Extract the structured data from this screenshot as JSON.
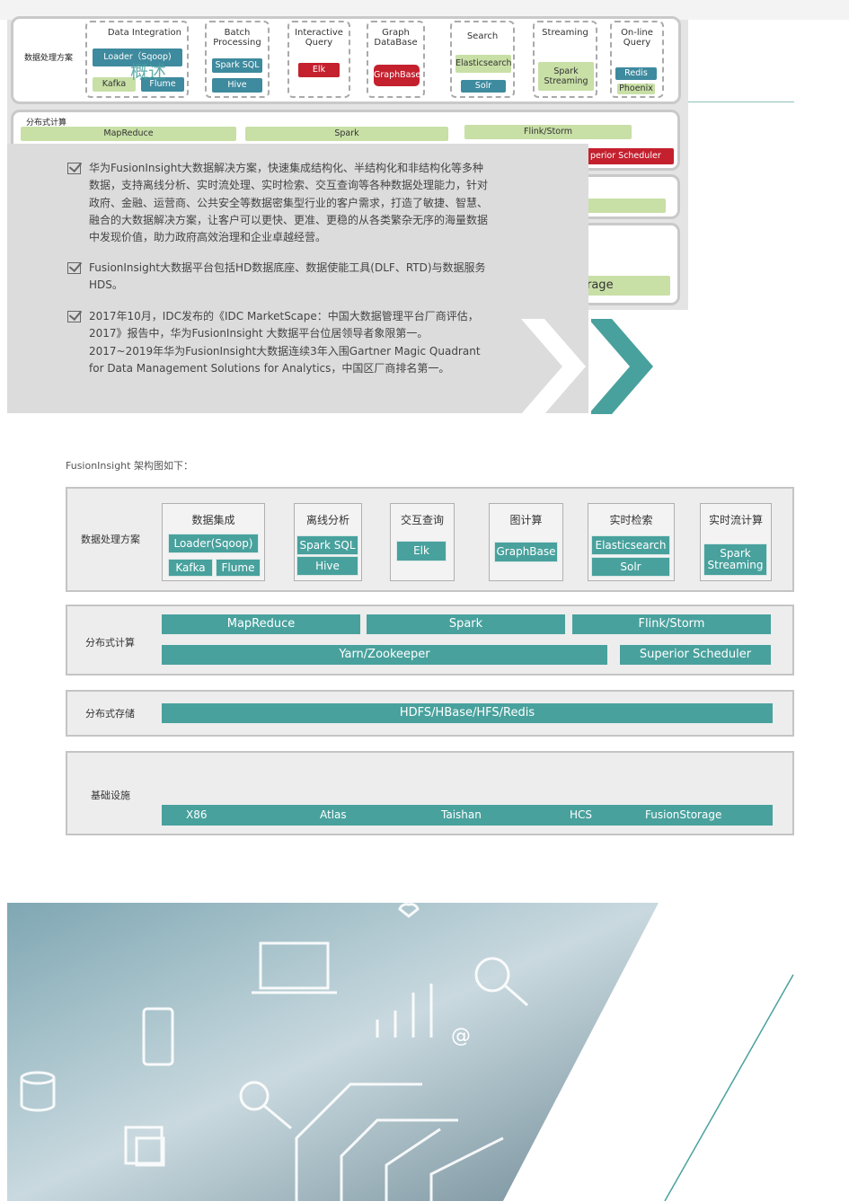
{
  "top_image": {
    "row1_label": "数据处理方案",
    "groups": [
      {
        "title": "Data Integration",
        "items": [
          "Loader（Sqoop)",
          "Kafka",
          "Flume"
        ]
      },
      {
        "title": "Batch Processing",
        "items": [
          "Spark SQL",
          "Hive"
        ]
      },
      {
        "title": "Interactive Query",
        "items": [
          "Elk"
        ]
      },
      {
        "title": "Graph DataBase",
        "items": [
          "GraphBase"
        ]
      },
      {
        "title": "Search",
        "items": [
          "Elasticsearch",
          "Solr"
        ]
      },
      {
        "title": "Streaming",
        "items": [
          "Spark Streaming"
        ]
      },
      {
        "title": "On-line Query",
        "items": [
          "Redis",
          "Phoenix"
        ]
      }
    ],
    "watermark": "概述",
    "row2_label": "分布式计算",
    "row2_items": [
      "MapReduce",
      "Spark",
      "Flink/Storm"
    ],
    "scheduler": "perior Scheduler",
    "storage_fragment": "rage"
  },
  "bullets": [
    "华为FusionInsight大数据解决方案，快速集成结构化、半结构化和非结构化等多种数据，支持离线分析、实时流处理、实时检索、交互查询等各种数据处理能力，针对政府、金融、运营商、公共安全等数据密集型行业的客户需求，打造了敏捷、智慧、融合的大数据解决方案，让客户可以更快、更准、更稳的从各类繁杂无序的海量数据中发现价值，助力政府高效治理和企业卓越经营。",
    "FusionInsight大数据平台包括HD数据底座、数据使能工具(DLF、RTD)与数据服务HDS。",
    "2017年10月，IDC发布的《IDC MarketScape：中国大数据管理平台厂商评估，2017》报告中，华为FusionInsight 大数据平台位居领导者象限第一。2017~2019年华为FusionInsight大数据连续3年入围Gartner Magic Quadrant for Data Management Solutions for Analytics，中国区厂商排名第一。"
  ],
  "intro": "FusionInsight 架构图如下：",
  "arch": {
    "processing": {
      "label": "数据处理方案",
      "groups": [
        {
          "title": "数据集成",
          "items": [
            "Loader(Sqoop)",
            "Kafka",
            "Flume"
          ]
        },
        {
          "title": "离线分析",
          "items": [
            "Spark SQL",
            "Hive"
          ]
        },
        {
          "title": "交互查询",
          "items": [
            "Elk"
          ]
        },
        {
          "title": "图计算",
          "items": [
            "GraphBase"
          ]
        },
        {
          "title": "实时检索",
          "items": [
            "Elasticsearch",
            "Solr"
          ]
        },
        {
          "title": "实时流计算",
          "items": [
            "Spark Streaming"
          ]
        }
      ]
    },
    "compute": {
      "label": "分布式计算",
      "items": [
        "MapReduce",
        "Spark",
        "Flink/Storm",
        "Yarn/Zookeeper",
        "Superior Scheduler"
      ]
    },
    "storage": {
      "label": "分布式存储",
      "items": [
        "HDFS/HBase/HFS/Redis"
      ]
    },
    "infra": {
      "label": "基础设施",
      "items": [
        "X86",
        "Atlas",
        "Taishan",
        "HCS",
        "FusionStorage"
      ]
    }
  },
  "colors": {
    "teal": "#48a19d",
    "red": "#c4202e",
    "green": "#c8dfa6",
    "blue": "#3e8a9e"
  }
}
